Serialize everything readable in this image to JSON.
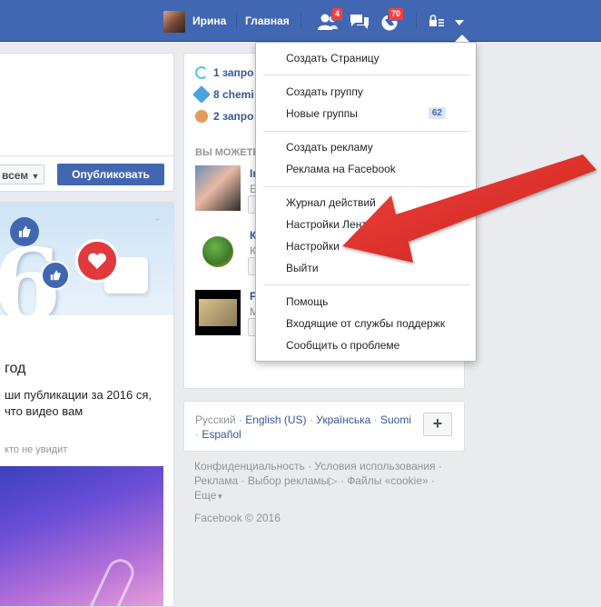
{
  "topbar": {
    "user_name": "Ирина",
    "home_label": "Главная",
    "friend_requests_count": "4",
    "notifications_count": "70"
  },
  "composer": {
    "audience_label": "всем",
    "publish_label": "Опубликовать"
  },
  "memory": {
    "title": "год",
    "text": "ши публикации за 2016 ся, что видео вам",
    "note": "кто не увидит"
  },
  "right": {
    "requests": [
      {
        "label": "1 запро"
      },
      {
        "label": "8 chemi"
      },
      {
        "label": "2 запро"
      }
    ],
    "section_label": "ВЫ МОЖЕТЕ",
    "suggestions": [
      {
        "name": "In",
        "sub": "Б"
      },
      {
        "name": "К",
        "sub": "К"
      },
      {
        "name": "F",
        "sub": "М"
      }
    ]
  },
  "languages": {
    "current": "Русский",
    "links": [
      "English (US)",
      "Українська",
      "Suomi",
      "Español"
    ],
    "plus_label": "+"
  },
  "footer": {
    "links": [
      "Конфиденциальность",
      "Условия использования",
      "Реклама",
      "Выбор рекламы",
      "Файлы «cookie»",
      "Еще"
    ],
    "copyright": "Facebook © 2016"
  },
  "menu": {
    "items": [
      {
        "label": "Создать Страницу"
      },
      {
        "label": "Создать группу"
      },
      {
        "label": "Новые группы",
        "badge": "62"
      },
      {
        "label": "Создать рекламу"
      },
      {
        "label": "Реклама на Facebook"
      },
      {
        "label": "Журнал действий"
      },
      {
        "label": "Настройки Ленты новостей"
      },
      {
        "label": "Настройки"
      },
      {
        "label": "Выйти"
      },
      {
        "label": "Помощь"
      },
      {
        "label": "Входящие от службы поддержк"
      },
      {
        "label": "Сообщить о проблеме"
      }
    ]
  },
  "colors": {
    "brand": "#4267b2",
    "badge": "#fa3e3e",
    "arrow": "#e8302a"
  }
}
